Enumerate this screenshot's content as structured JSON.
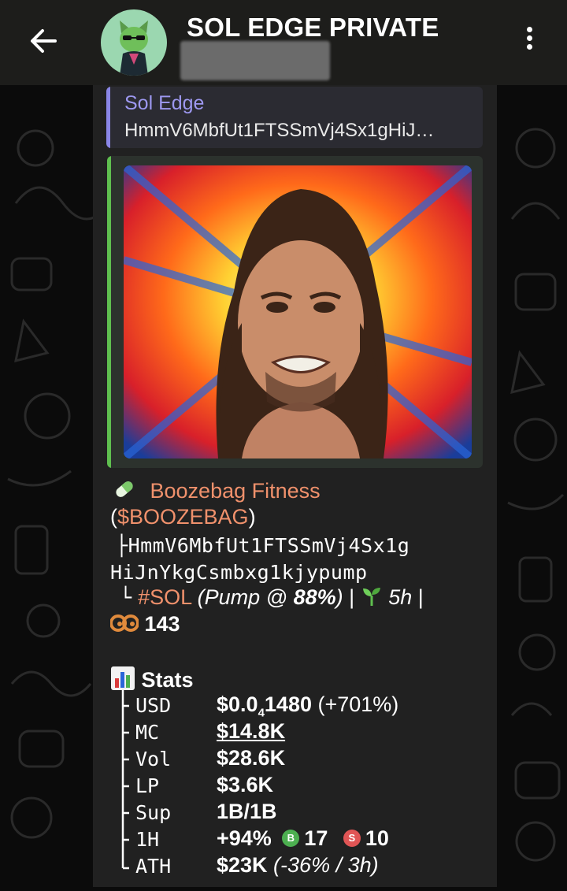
{
  "header": {
    "title": "SOL EDGE PRIVATE"
  },
  "reply": {
    "name": "Sol Edge",
    "text": "HmmV6MbfUt1FTSSmVj4Sx1gHiJ…"
  },
  "message": {
    "token_icon": "pill-icon",
    "token_name": "Boozebag Fitness",
    "paren_open": "(",
    "ticker": "$BOOZEBAG",
    "paren_close": ")",
    "tree_branch": "├",
    "address_line1": "HmmV6MbfUt1FTSSmVj4Sx1g",
    "address_line2": "HiJnYkgCsmbxg1kjypump",
    "tree_end": "└",
    "chain_tag": "#SOL",
    "pump_prefix": "(Pump @ ",
    "pump_value": "88%",
    "pump_suffix": ")",
    "sep": "|",
    "age_icon": "seedling-icon",
    "age": "5h",
    "holders_icon": "eyes-icon",
    "holders": "143",
    "stats_icon": "bar-chart-icon",
    "stats_title": "Stats"
  },
  "stats": [
    {
      "key": "USD",
      "value": "$0.0",
      "sub": "4",
      "value2": "1480",
      "extra": " (+701%)"
    },
    {
      "key": "MC",
      "value": "$14.8K"
    },
    {
      "key": "Vol",
      "value": "$28.6K"
    },
    {
      "key": "LP",
      "value": "$3.6K"
    },
    {
      "key": "Sup",
      "value": "1B/1B"
    },
    {
      "key": "1H",
      "value": "+94%",
      "buy_badge": "B",
      "buys": "17",
      "sell_badge": "S",
      "sells": "10"
    },
    {
      "key": "ATH",
      "value": "$23K",
      "extra": " (-36% / 3h)"
    }
  ],
  "colors": {
    "accent_reply": "#9d98f0",
    "accent_media": "#5fbf4f",
    "ticker": "#f0916c",
    "buy": "#4caf50",
    "sell": "#e05555"
  }
}
